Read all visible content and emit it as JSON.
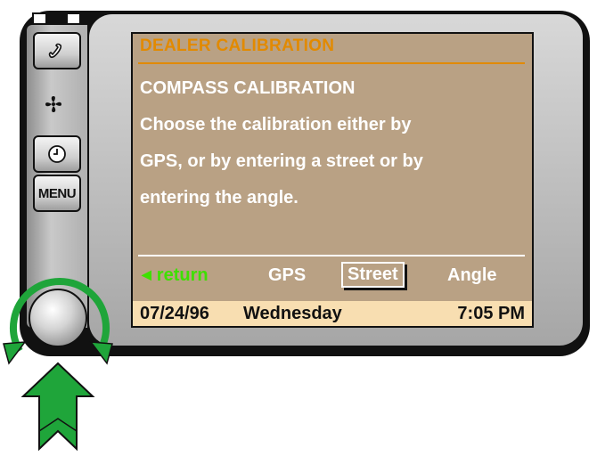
{
  "device": {
    "indicators": [
      {
        "state": "off"
      },
      {
        "state": "on"
      },
      {
        "state": "off"
      }
    ],
    "buttons": [
      {
        "name": "phone-button",
        "icon": "phone-icon"
      },
      {
        "name": "clock-button",
        "icon": "clock-icon"
      },
      {
        "name": "menu-button",
        "label": "MENU"
      }
    ],
    "fan_icon": "fan-icon",
    "knob": "rotary-knob"
  },
  "screen": {
    "section_title": "DEALER CALIBRATION",
    "heading": "COMPASS CALIBRATION",
    "body_lines": [
      "Choose the calibration either by",
      "GPS, or by entering a street or by",
      "entering the angle."
    ],
    "options": {
      "return_label": "return",
      "gps_label": "GPS",
      "street_label": "Street",
      "angle_label": "Angle",
      "selected": "Street"
    },
    "status": {
      "date": "07/24/96",
      "day": "Wednesday",
      "time": "7:05 PM"
    }
  },
  "colors": {
    "screen_bg": "#b9a184",
    "title_orange": "#e28a00",
    "return_green": "#3ee000",
    "status_bg": "#f8deb1",
    "annotation_green": "#1fa53a"
  },
  "annotations": {
    "rotate_arrows": "rotate-arrows",
    "press_arrow": "press-arrow"
  }
}
